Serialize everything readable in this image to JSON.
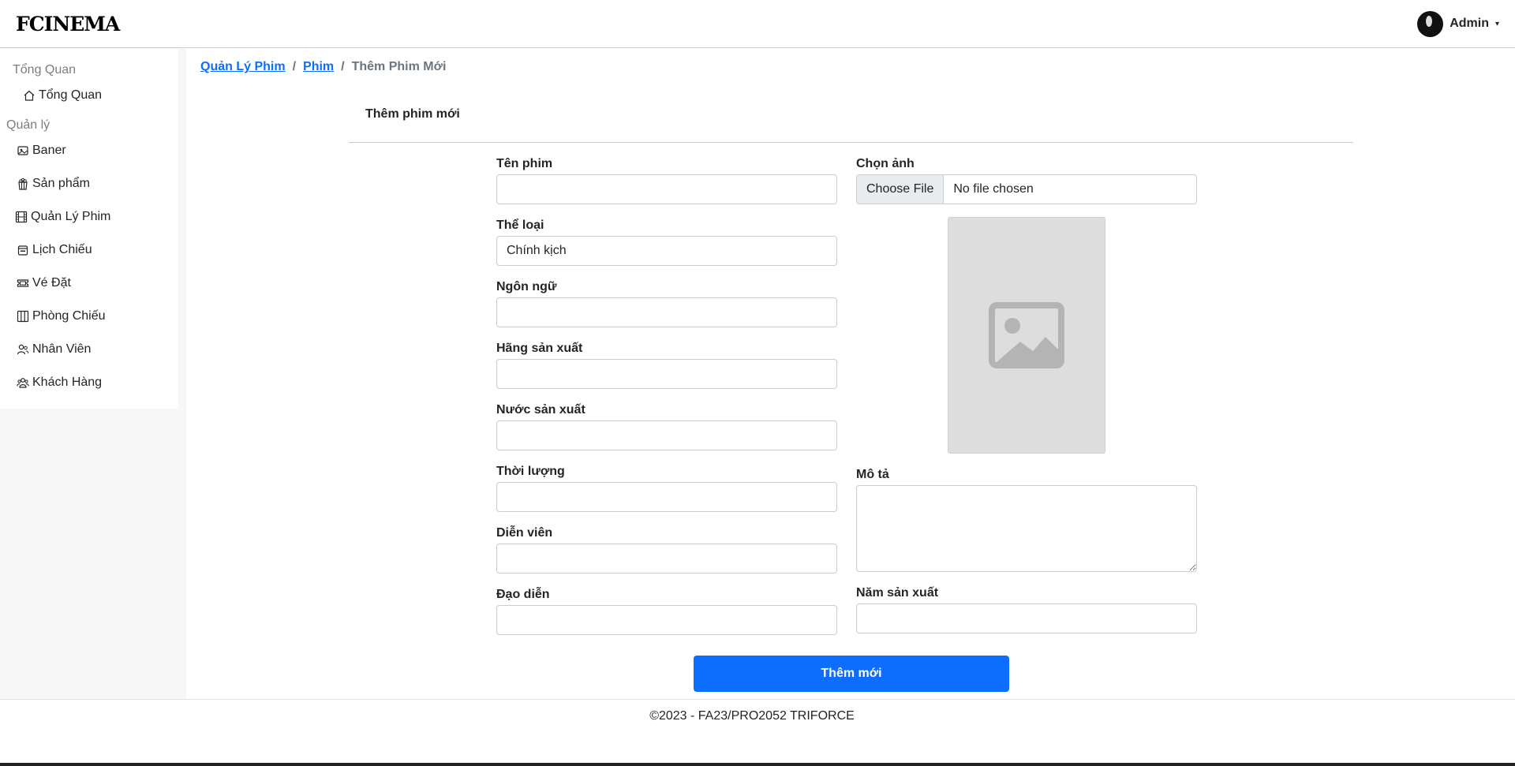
{
  "header": {
    "logo": "FCINEMA",
    "user_name": "Admin"
  },
  "sidebar": {
    "overview_label": "Tổng Quan",
    "overview_item": "Tổng Quan",
    "manage_label": "Quản lý",
    "items": [
      {
        "label": "Baner",
        "icon": "banner-icon"
      },
      {
        "label": "Sản phẩm",
        "icon": "popcorn-icon"
      },
      {
        "label": "Quản Lý Phim",
        "icon": "film-icon"
      },
      {
        "label": "Lịch Chiếu",
        "icon": "calendar-icon"
      },
      {
        "label": "Vé Đặt",
        "icon": "ticket-icon"
      },
      {
        "label": "Phòng Chiếu",
        "icon": "columns-icon"
      },
      {
        "label": "Nhân Viên",
        "icon": "people-icon"
      },
      {
        "label": "Khách Hàng",
        "icon": "customers-icon"
      }
    ]
  },
  "breadcrumb": {
    "level1": "Quản Lý Phim",
    "level2": "Phim",
    "current": "Thêm Phim Mới",
    "separator": "/"
  },
  "form": {
    "title": "Thêm phim mới",
    "fields": {
      "ten_phim": {
        "label": "Tên phim",
        "value": ""
      },
      "the_loai": {
        "label": "Thể loại",
        "value": "Chính kịch"
      },
      "ngon_ngu": {
        "label": "Ngôn ngữ",
        "value": ""
      },
      "hang_san_xuat": {
        "label": "Hãng sản xuất",
        "value": ""
      },
      "nuoc_san_xuat": {
        "label": "Nước sản xuất",
        "value": ""
      },
      "thoi_luong": {
        "label": "Thời lượng",
        "value": ""
      },
      "dien_vien": {
        "label": "Diễn viên",
        "value": ""
      },
      "dao_dien": {
        "label": "Đạo diễn",
        "value": ""
      },
      "chon_anh": {
        "label": "Chọn ảnh",
        "button": "Choose File",
        "status": "No file chosen"
      },
      "mo_ta": {
        "label": "Mô tả",
        "value": ""
      },
      "nam_san_xuat": {
        "label": "Năm sản xuất",
        "value": ""
      }
    },
    "submit_label": "Thêm mới"
  },
  "footer": {
    "text": "©2023 - FA23/PRO2052 TRIFORCE"
  },
  "colors": {
    "primary": "#0d6efd",
    "sidebar_bg": "#f7f7f7",
    "placeholder_bg": "#dddddd"
  }
}
